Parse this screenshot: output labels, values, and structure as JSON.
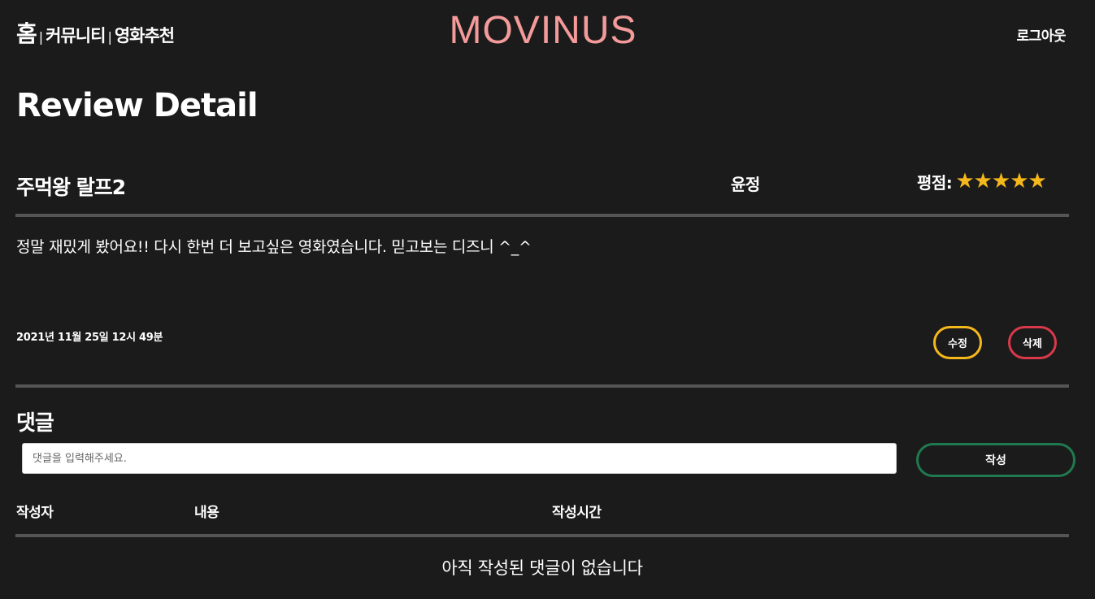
{
  "nav": {
    "home": "홈",
    "separator": "|",
    "community": "커뮤니티",
    "recommend": "영화추천",
    "logo": "MOVINUS",
    "logout": "로그아웃"
  },
  "page": {
    "title": "Review Detail"
  },
  "review": {
    "movie_title": "주먹왕 랄프2",
    "author": "윤정",
    "rating_label": "평점:",
    "rating_stars": "★★★★★",
    "rating_value": 5,
    "rating_max": 5,
    "content": "정말 재밌게 봤어요!! 다시 한번 더 보고싶은 영화였습니다. 믿고보는 디즈니 ^_^",
    "created_at": "2021년 11월 25일 12시 49분",
    "edit_label": "수정",
    "delete_label": "삭제"
  },
  "comments": {
    "heading": "댓글",
    "input_placeholder": "댓글을 입력해주세요.",
    "input_value": "",
    "submit_label": "작성",
    "columns": [
      "작성자",
      "내용",
      "작성시간"
    ],
    "empty_message": "아직 작성된 댓글이 없습니다"
  },
  "colors": {
    "background": "#1c1b1b",
    "logo": "#f39a9a",
    "star": "#f5b81c",
    "edit_border": "#f5b81c",
    "delete_border": "#d9394a",
    "submit_border": "#1f7a4f",
    "divider": "#555555"
  }
}
